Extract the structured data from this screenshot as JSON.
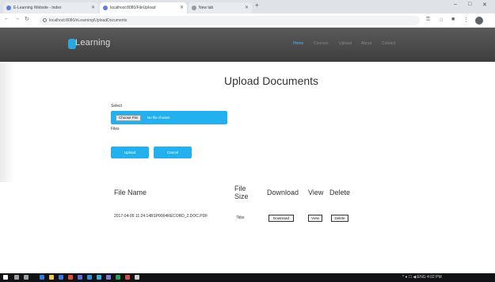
{
  "browser": {
    "tabs": [
      {
        "title": "E-Learning Website - Index"
      },
      {
        "title": "localhost:8080/FileUpload"
      },
      {
        "title": "New tab"
      }
    ],
    "new_tab_symbol": "+",
    "address": "localhost:8080/eLearning/UploadDocuments",
    "window_controls": [
      "–",
      "□",
      "✕"
    ],
    "nav": {
      "back": "←",
      "forward": "→",
      "reload": "↻"
    }
  },
  "site": {
    "logo_text": "Learning",
    "brand_color": "#2aa8e0",
    "nav_links": [
      "Home",
      "Courses",
      "Upload",
      "About",
      "Contact"
    ]
  },
  "page": {
    "title": "Upload Documents",
    "upload_label": "Select",
    "choose_file_label": "Choose File",
    "no_file_text": "No file chosen",
    "files_label": "Files",
    "upload_button": "Upload",
    "cancel_button": "Cancel"
  },
  "table": {
    "headers": [
      "File Name",
      "File Size",
      "Download",
      "View",
      "Delete"
    ],
    "rows": [
      {
        "file_name": "2017-04-05 11:24:14BSP0004RECORD_2.DOC.PDF",
        "file_size": "7kbs",
        "download_label": "Download",
        "view_label": "View",
        "delete_label": "Delete"
      }
    ]
  },
  "taskbar": {
    "tray_text": "^ ♦ ☐ ◀ ENG 4:02 PM"
  }
}
